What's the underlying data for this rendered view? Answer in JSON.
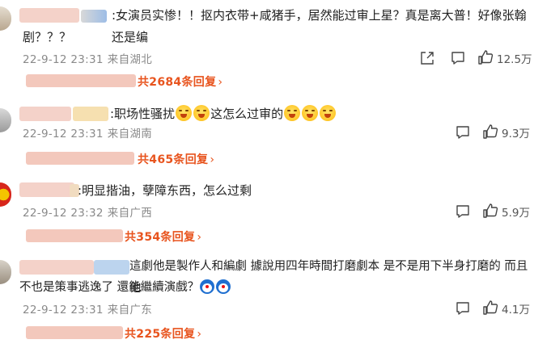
{
  "comments": [
    {
      "prefix": ":女演员实惨！！抠内衣带+咸猪手，居然能过审上星？真是离大普！好像张翰还是编",
      "line2": "剧？？？",
      "date": "22-9-12 23:31",
      "location": "来自湖北",
      "likes": "12.5万",
      "reply": "共2684条回复"
    },
    {
      "prefix": ":职场性骚扰",
      "middle": "这怎么过审的",
      "date": "22-9-12 23:31",
      "location": "来自湖南",
      "likes": "9.3万",
      "reply": "共465条回复"
    },
    {
      "prefix": ":明显揩油，孽障东西，怎么过剩",
      "date": "22-9-12 23:32",
      "location": "来自广西",
      "likes": "5.9万",
      "reply": "共354条回复"
    },
    {
      "prefix": "這劇他是製作人和編劇 據說用四年時間打磨劇本 是不是用下半身打磨的 而且他",
      "line2": "不也是策事逃逸了 還能繼續演戲？",
      "date": "22-9-12 23:31",
      "location": "来自广东",
      "likes": "4.1万",
      "reply": "共225条回复"
    }
  ],
  "icons": {
    "share": "share-icon",
    "comment": "comment-icon",
    "like": "thumbs-up-icon",
    "reply_arrow": "chevron-right-icon"
  },
  "colors": {
    "reply": "#e8541e",
    "meta": "#8a8a8a",
    "censor": "#f3c8bc"
  }
}
